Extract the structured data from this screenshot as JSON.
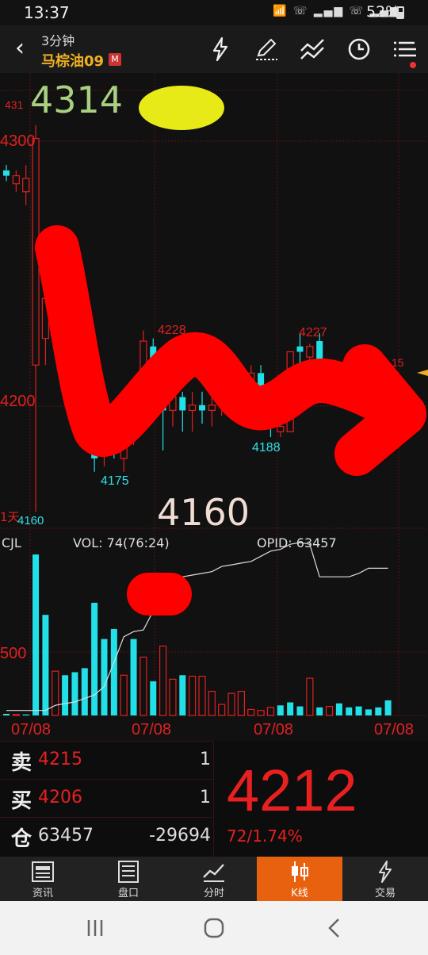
{
  "status_bar": {
    "time": "13:37",
    "battery": "52%",
    "icons": [
      "wifi-icon",
      "call-icon",
      "signal-icon",
      "signal-icon",
      "battery-icon"
    ]
  },
  "header": {
    "period": "3分钟",
    "instrument": "马棕油09",
    "badge": "M",
    "icons": [
      "lightning-icon",
      "draw-icon",
      "indicator-icon",
      "clock-icon",
      "menu-icon"
    ]
  },
  "chart": {
    "handwritten_high": "4314",
    "handwritten_low": "4160",
    "price_labels": {
      "p4300": "4300",
      "p4200": "4200",
      "low_marker": "4160",
      "top_marker": "431",
      "period_tag": "1天",
      "right_tag": "15"
    },
    "annotations": {
      "a4228": "4228",
      "a4227": "4227",
      "a4175": "4175",
      "a4188": "4188"
    },
    "indicator": {
      "name": "CJL",
      "vol": "VOL: 74(76:24)",
      "opid": "OPID: 63457",
      "axis_500": "500"
    },
    "dates": [
      "07/08",
      "07/08",
      "07/08",
      "07/08"
    ],
    "colors": {
      "up": "#e02020",
      "down": "#22e0e8",
      "grid": "#5a1414"
    }
  },
  "chart_data": {
    "type": "candlestick",
    "ylim": [
      4155,
      4318
    ],
    "candles": [
      {
        "o": 4288,
        "h": 4290,
        "l": 4284,
        "c": 4286
      },
      {
        "o": 4283,
        "h": 4288,
        "l": 4280,
        "c": 4286
      },
      {
        "o": 4280,
        "h": 4290,
        "l": 4275,
        "c": 4285
      },
      {
        "o": 4215,
        "h": 4305,
        "l": 4160,
        "c": 4300
      },
      {
        "o": 4225,
        "h": 4260,
        "l": 4215,
        "c": 4240
      },
      {
        "o": 4255,
        "h": 4258,
        "l": 4232,
        "c": 4235
      },
      {
        "o": 4234,
        "h": 4240,
        "l": 4218,
        "c": 4220
      },
      {
        "o": 4208,
        "h": 4213,
        "l": 4199,
        "c": 4204
      },
      {
        "o": 4202,
        "h": 4205,
        "l": 4185,
        "c": 4190
      },
      {
        "o": 4190,
        "h": 4195,
        "l": 4175,
        "c": 4180
      },
      {
        "o": 4182,
        "h": 4190,
        "l": 4177,
        "c": 4186
      },
      {
        "o": 4190,
        "h": 4196,
        "l": 4180,
        "c": 4185
      },
      {
        "o": 4180,
        "h": 4195,
        "l": 4175,
        "c": 4195
      },
      {
        "o": 4195,
        "h": 4205,
        "l": 4185,
        "c": 4200
      },
      {
        "o": 4205,
        "h": 4228,
        "l": 4200,
        "c": 4224
      },
      {
        "o": 4222,
        "h": 4225,
        "l": 4198,
        "c": 4200
      },
      {
        "o": 4200,
        "h": 4205,
        "l": 4183,
        "c": 4198
      },
      {
        "o": 4198,
        "h": 4207,
        "l": 4192,
        "c": 4203
      },
      {
        "o": 4203,
        "h": 4205,
        "l": 4190,
        "c": 4198
      },
      {
        "o": 4198,
        "h": 4205,
        "l": 4190,
        "c": 4200
      },
      {
        "o": 4200,
        "h": 4205,
        "l": 4193,
        "c": 4198
      },
      {
        "o": 4198,
        "h": 4204,
        "l": 4192,
        "c": 4200
      },
      {
        "o": 4200,
        "h": 4212,
        "l": 4196,
        "c": 4207
      },
      {
        "o": 4208,
        "h": 4212,
        "l": 4200,
        "c": 4210
      },
      {
        "o": 4210,
        "h": 4214,
        "l": 4202,
        "c": 4204
      },
      {
        "o": 4202,
        "h": 4215,
        "l": 4200,
        "c": 4212
      },
      {
        "o": 4212,
        "h": 4215,
        "l": 4195,
        "c": 4200
      },
      {
        "o": 4195,
        "h": 4202,
        "l": 4188,
        "c": 4192
      },
      {
        "o": 4190,
        "h": 4196,
        "l": 4188,
        "c": 4192
      },
      {
        "o": 4190,
        "h": 4220,
        "l": 4190,
        "c": 4220
      },
      {
        "o": 4222,
        "h": 4227,
        "l": 4212,
        "c": 4220
      },
      {
        "o": 4218,
        "h": 4223,
        "l": 4214,
        "c": 4222
      },
      {
        "o": 4224,
        "h": 4227,
        "l": 4212,
        "c": 4214
      },
      {
        "o": 4212,
        "h": 4216,
        "l": 4205,
        "c": 4209
      },
      {
        "o": 4209,
        "h": 4214,
        "l": 4204,
        "c": 4210
      },
      {
        "o": 4210,
        "h": 4214,
        "l": 4205,
        "c": 4207
      },
      {
        "o": 4207,
        "h": 4212,
        "l": 4202,
        "c": 4210
      },
      {
        "o": 4210,
        "h": 4214,
        "l": 4205,
        "c": 4212
      },
      {
        "o": 4212,
        "h": 4216,
        "l": 4206,
        "c": 4210
      },
      {
        "o": 4210,
        "h": 4215,
        "l": 4205,
        "c": 4213
      }
    ],
    "volume": [
      {
        "v": 8,
        "up": false
      },
      {
        "v": 5,
        "up": true
      },
      {
        "v": 5,
        "up": false
      },
      {
        "v": 800,
        "up": false
      },
      {
        "v": 500,
        "up": false
      },
      {
        "v": 220,
        "up": true
      },
      {
        "v": 200,
        "up": false
      },
      {
        "v": 215,
        "up": false
      },
      {
        "v": 235,
        "up": false
      },
      {
        "v": 560,
        "up": false
      },
      {
        "v": 380,
        "up": false
      },
      {
        "v": 430,
        "up": false
      },
      {
        "v": 200,
        "up": true
      },
      {
        "v": 380,
        "up": false
      },
      {
        "v": 290,
        "up": true
      },
      {
        "v": 170,
        "up": false
      },
      {
        "v": 345,
        "up": true
      },
      {
        "v": 180,
        "up": true
      },
      {
        "v": 200,
        "up": false
      },
      {
        "v": 195,
        "up": true
      },
      {
        "v": 195,
        "up": true
      },
      {
        "v": 120,
        "up": true
      },
      {
        "v": 55,
        "up": true
      },
      {
        "v": 110,
        "up": true
      },
      {
        "v": 120,
        "up": true
      },
      {
        "v": 30,
        "up": true
      },
      {
        "v": 25,
        "up": true
      },
      {
        "v": 40,
        "up": true
      },
      {
        "v": 50,
        "up": false
      },
      {
        "v": 65,
        "up": false
      },
      {
        "v": 45,
        "up": false
      },
      {
        "v": 185,
        "up": true
      },
      {
        "v": 40,
        "up": false
      },
      {
        "v": 45,
        "up": true
      },
      {
        "v": 60,
        "up": false
      },
      {
        "v": 40,
        "up": false
      },
      {
        "v": 45,
        "up": false
      },
      {
        "v": 30,
        "up": false
      },
      {
        "v": 40,
        "up": false
      },
      {
        "v": 75,
        "up": false
      }
    ],
    "opid_line": [
      20,
      20,
      20,
      20,
      20,
      50,
      60,
      70,
      90,
      110,
      160,
      300,
      450,
      480,
      490,
      600,
      760,
      790,
      800,
      810,
      820,
      830,
      860,
      870,
      880,
      890,
      920,
      950,
      960,
      990,
      1000,
      990,
      800,
      800,
      800,
      800,
      820,
      850,
      850,
      850
    ]
  },
  "quote": {
    "sell_label": "卖",
    "sell_price": "4215",
    "sell_vol": "1",
    "buy_label": "买",
    "buy_price": "4206",
    "buy_vol": "1",
    "oi_label": "仓",
    "oi_value": "63457",
    "oi_change": "-29694",
    "last_price": "4212",
    "change": "72/1.74%"
  },
  "tabs": [
    {
      "label": "资讯",
      "icon": "news-icon"
    },
    {
      "label": "盘口",
      "icon": "orderbook-icon"
    },
    {
      "label": "分时",
      "icon": "timeshare-icon"
    },
    {
      "label": "K线",
      "icon": "candlestick-icon",
      "active": true
    },
    {
      "label": "交易",
      "icon": "trade-icon"
    }
  ]
}
